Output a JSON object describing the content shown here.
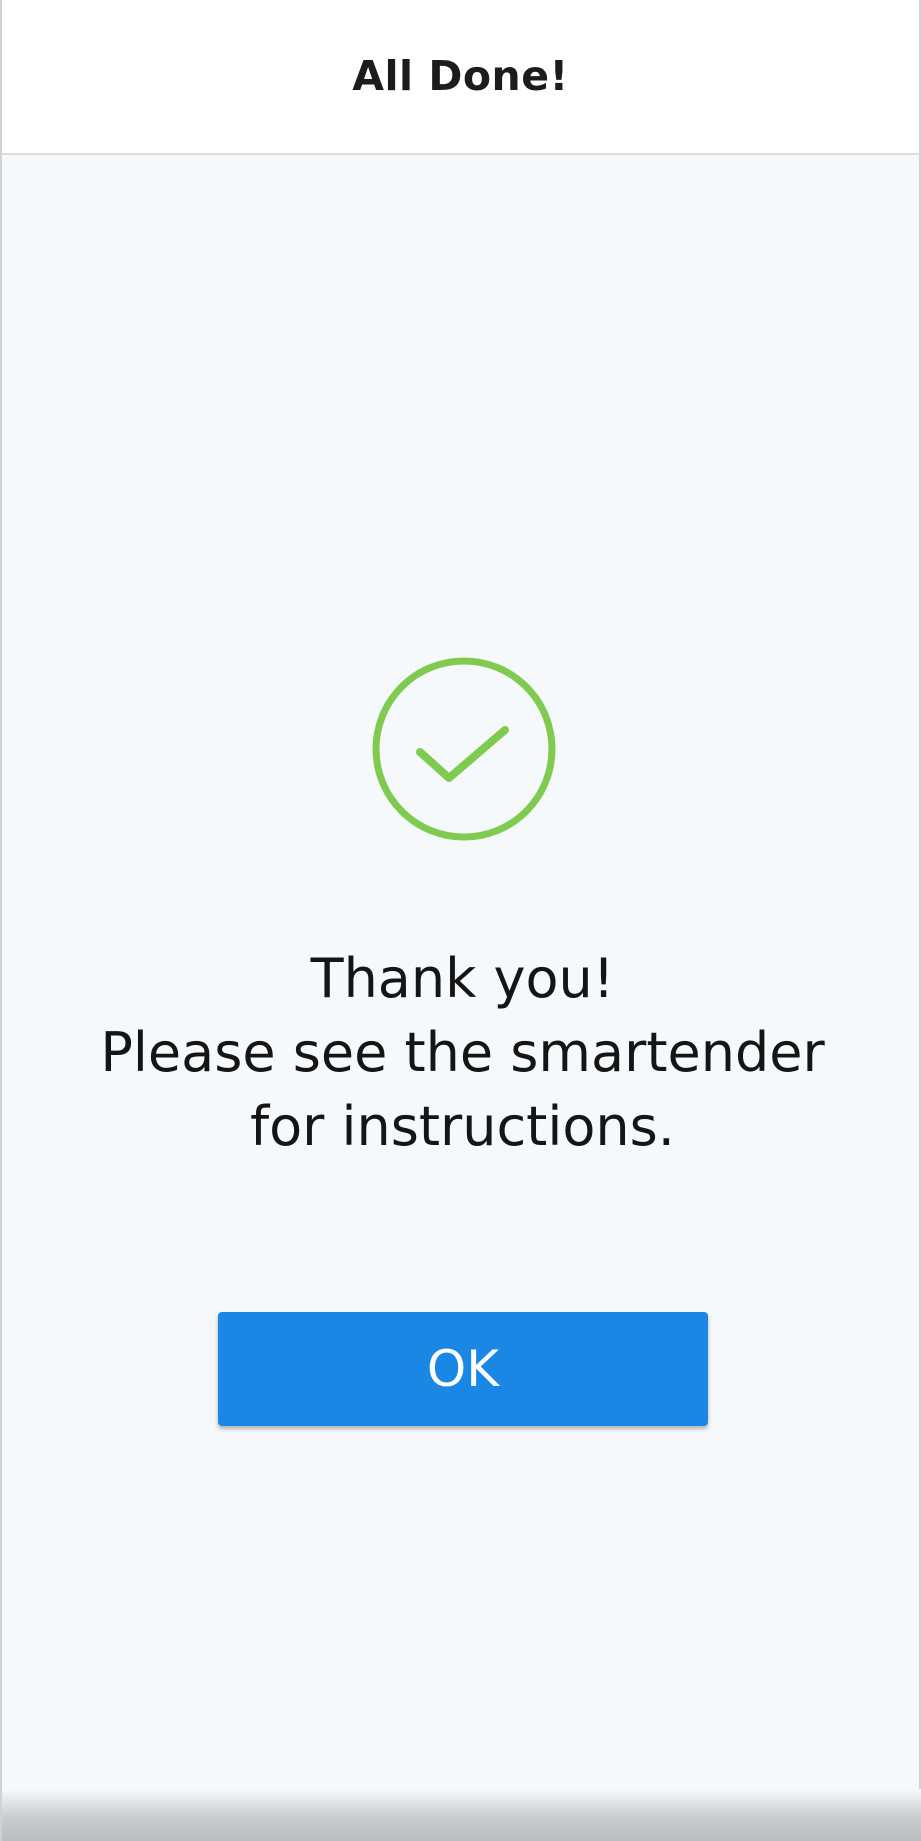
{
  "header": {
    "title": "All Done!"
  },
  "status": {
    "icon": "checkmark-circle-icon",
    "color": "#7ecb4f"
  },
  "message": {
    "line1": "Thank you!",
    "line2": "Please see the smartender",
    "line3": "for instructions."
  },
  "actions": {
    "ok_label": "OK",
    "ok_color": "#1a87e4"
  }
}
